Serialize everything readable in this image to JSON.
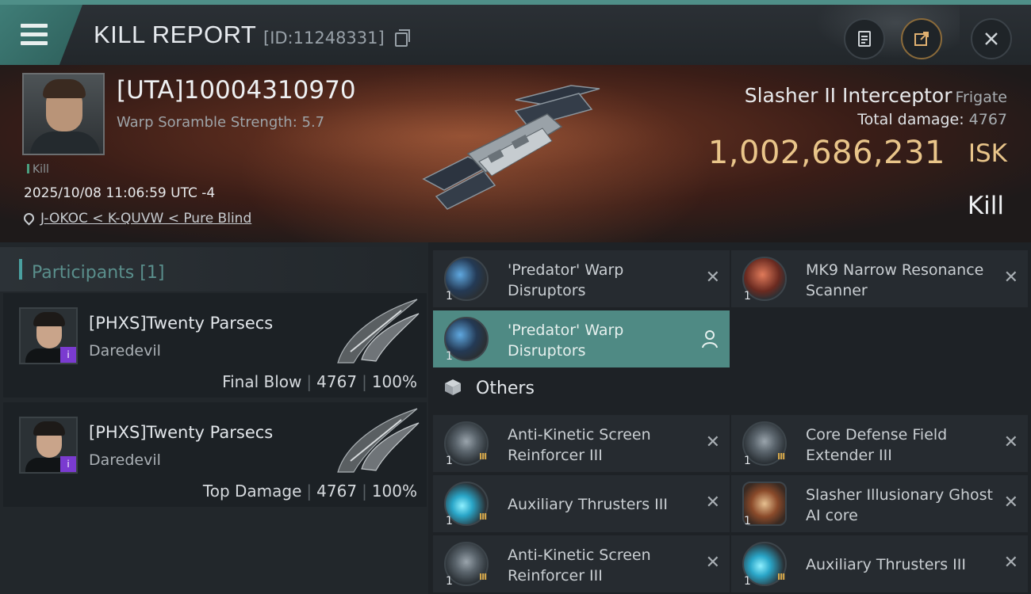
{
  "header": {
    "title": "KILL REPORT",
    "report_id": "[ID:11248331]"
  },
  "victim": {
    "name": "[UTA]10004310970",
    "scram_strength": "Warp Soramble Strength: 5.7",
    "kill_tag": "Kill",
    "datetime": "2025/10/08 11:06:59 UTC -4",
    "location": "J-OKOC < K-QUVW < Pure Blind",
    "ship_name": "Slasher II Interceptor",
    "ship_class": "Frigate",
    "total_damage_label": "Total damage:",
    "total_damage_value": "4767",
    "isk_value": "1,002,686,231",
    "isk_unit": "ISK",
    "result": "Kill"
  },
  "participants": {
    "title": "Participants",
    "count": "[1]",
    "items": [
      {
        "name": "[PHXS]Twenty Parsecs",
        "ship": "Daredevil",
        "role": "Final Blow",
        "damage": "4767",
        "percent": "100%",
        "sep1": "|",
        "sep2": "|"
      },
      {
        "name": "[PHXS]Twenty Parsecs",
        "ship": "Daredevil",
        "role": "Top Damage",
        "damage": "4767",
        "percent": "100%",
        "sep1": "|",
        "sep2": "|"
      }
    ]
  },
  "modules": {
    "top": [
      {
        "name": "'Predator' Warp Disruptors",
        "qty": "1",
        "icon": "warp-disruptor-icon"
      },
      {
        "name": "MK9 Narrow Resonance Scanner",
        "qty": "1",
        "icon": "scanner-icon"
      },
      {
        "name": "'Predator' Warp Disruptors",
        "qty": "1",
        "icon": "warp-disruptor-icon"
      }
    ],
    "others_label": "Others",
    "others": [
      {
        "name": "Anti-Kinetic Screen Reinforcer III",
        "qty": "1",
        "tier": "III"
      },
      {
        "name": "Core Defense Field Extender III",
        "qty": "1",
        "tier": "III"
      },
      {
        "name": "Auxiliary Thrusters III",
        "qty": "1",
        "tier": "III"
      },
      {
        "name": "Slasher Illusionary Ghost AI core",
        "qty": "1",
        "tier": ""
      },
      {
        "name": "Anti-Kinetic Screen Reinforcer III",
        "qty": "1",
        "tier": "III"
      },
      {
        "name": "Auxiliary Thrusters III",
        "qty": "1",
        "tier": "III"
      }
    ],
    "remove_glyph": "✕"
  },
  "colors": {
    "accent": "#4f8f88",
    "isk_gold": "#e9c58a",
    "highlight_row": "#4f8a84"
  }
}
